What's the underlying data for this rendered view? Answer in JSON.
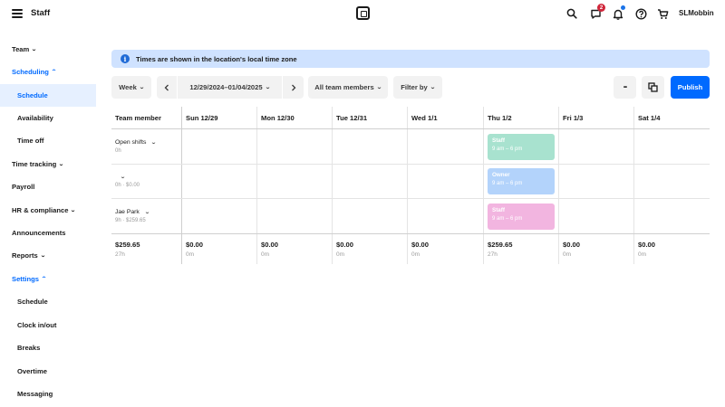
{
  "header": {
    "title": "Staff",
    "notifications_badge": "2",
    "username": "SLMobbin"
  },
  "sidebar": {
    "items": [
      {
        "label": "Team",
        "level": "top",
        "caret": "down"
      },
      {
        "label": "Scheduling",
        "level": "top",
        "caret": "up",
        "active_group": true
      },
      {
        "label": "Schedule",
        "level": "sub",
        "selected": true
      },
      {
        "label": "Availability",
        "level": "sub"
      },
      {
        "label": "Time off",
        "level": "sub"
      },
      {
        "label": "Time tracking",
        "level": "top",
        "caret": "down"
      },
      {
        "label": "Payroll",
        "level": "top"
      },
      {
        "label": "HR & compliance",
        "level": "top",
        "caret": "down"
      },
      {
        "label": "Announcements",
        "level": "top"
      },
      {
        "label": "Reports",
        "level": "top",
        "caret": "down"
      },
      {
        "label": "Settings",
        "level": "top",
        "caret": "up",
        "active_group": true
      },
      {
        "label": "Schedule",
        "level": "sub"
      },
      {
        "label": "Clock in/out",
        "level": "sub"
      },
      {
        "label": "Breaks",
        "level": "sub"
      },
      {
        "label": "Overtime",
        "level": "sub"
      },
      {
        "label": "Messaging",
        "level": "sub"
      }
    ]
  },
  "banner": {
    "text": "Times are shown in the location's local time zone"
  },
  "toolbar": {
    "view_label": "Week",
    "date_range": "12/29/2024–01/04/2025",
    "members_filter": "All team members",
    "filter_by": "Filter by",
    "more_label": "•••",
    "publish_label": "Publish"
  },
  "schedule": {
    "member_header": "Team member",
    "days": [
      "Sun 12/29",
      "Mon 12/30",
      "Tue 12/31",
      "Wed 1/1",
      "Thu 1/2",
      "Fri 1/3",
      "Sat 1/4"
    ],
    "rows": [
      {
        "name": "Open shifts",
        "sub": "0h"
      },
      {
        "name": "",
        "sub": "0h · $0.00"
      },
      {
        "name": "Jae Park",
        "sub": "9h · $259.65"
      }
    ],
    "shifts": [
      {
        "role": "Staff",
        "time": "9 am – 6 pm",
        "color": "#a8e2cf"
      },
      {
        "role": "Owner",
        "time": "9 am – 6 pm",
        "color": "#b3d3fb"
      },
      {
        "role": "Staff",
        "time": "9 am – 6 pm",
        "color": "#f2b5e0"
      }
    ],
    "totals": {
      "member": {
        "amount": "$259.65",
        "hours": "27h"
      },
      "days": [
        {
          "amount": "$0.00",
          "hours": "0m"
        },
        {
          "amount": "$0.00",
          "hours": "0m"
        },
        {
          "amount": "$0.00",
          "hours": "0m"
        },
        {
          "amount": "$0.00",
          "hours": "0m"
        },
        {
          "amount": "$259.65",
          "hours": "27h"
        },
        {
          "amount": "$0.00",
          "hours": "0m"
        },
        {
          "amount": "$0.00",
          "hours": "0m"
        }
      ]
    }
  },
  "colors": {
    "accent": "#006aff",
    "banner_bg": "#cfe2ff",
    "selected_bg": "#e6f0ff",
    "badge": "#d0263a"
  }
}
